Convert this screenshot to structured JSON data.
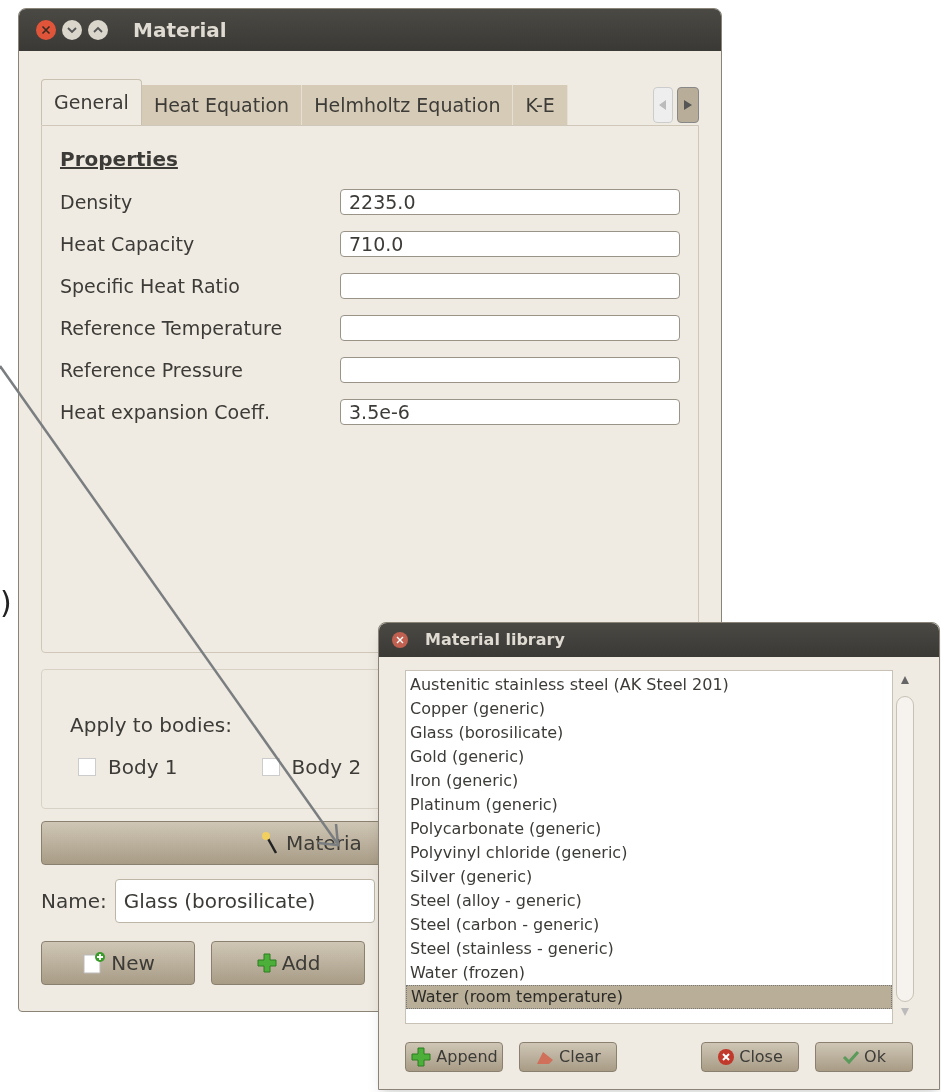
{
  "edge_text": ")",
  "main_window": {
    "title": "Material",
    "tabs": [
      {
        "label": "General",
        "selected": true
      },
      {
        "label": "Heat Equation",
        "selected": false
      },
      {
        "label": "Helmholtz Equation",
        "selected": false
      },
      {
        "label": "K-E",
        "selected": false
      }
    ],
    "section_title": "Properties",
    "properties": [
      {
        "label": "Density",
        "value": "2235.0"
      },
      {
        "label": "Heat Capacity",
        "value": "710.0"
      },
      {
        "label": "Specific Heat Ratio"
      },
      {
        "label": "Reference Temperature"
      },
      {
        "label": "Reference Pressure"
      },
      {
        "label": "Heat expansion Coeff.",
        "value": "3.5e-6"
      }
    ],
    "apply_label": "Apply to bodies:",
    "bodies": [
      {
        "label": "Body 1",
        "checked": false
      },
      {
        "label": "Body 2",
        "checked": false
      }
    ],
    "library_button": "Materia",
    "name_label": "Name:",
    "name_value": "Glass (borosilicate)",
    "buttons": [
      {
        "kind": "new",
        "label": "New"
      },
      {
        "kind": "add",
        "label": "Add"
      }
    ]
  },
  "library_dialog": {
    "title": "Material library",
    "items": [
      {
        "label": "Austenitic stainless steel (AK Steel 201)",
        "selected": false
      },
      {
        "label": "Copper (generic)",
        "selected": false
      },
      {
        "label": "Glass (borosilicate)",
        "selected": false
      },
      {
        "label": "Gold (generic)",
        "selected": false
      },
      {
        "label": "Iron (generic)",
        "selected": false
      },
      {
        "label": "Platinum (generic)",
        "selected": false
      },
      {
        "label": "Polycarbonate (generic)",
        "selected": false
      },
      {
        "label": "Polyvinyl chloride (generic)",
        "selected": false
      },
      {
        "label": "Silver (generic)",
        "selected": false
      },
      {
        "label": "Steel (alloy - generic)",
        "selected": false
      },
      {
        "label": "Steel (carbon - generic)",
        "selected": false
      },
      {
        "label": "Steel (stainless - generic)",
        "selected": false
      },
      {
        "label": "Water (frozen)",
        "selected": false
      },
      {
        "label": "Water (room temperature)",
        "selected": true
      }
    ],
    "buttons": [
      {
        "kind": "append",
        "label": "Append"
      },
      {
        "kind": "clear",
        "label": "Clear"
      },
      {
        "kind": "close",
        "label": "Close"
      },
      {
        "kind": "ok",
        "label": "Ok"
      }
    ]
  }
}
